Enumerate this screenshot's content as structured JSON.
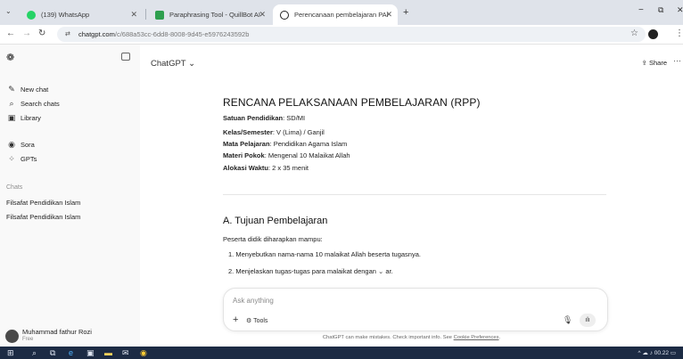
{
  "browser": {
    "tabs": [
      {
        "title": "(139) WhatsApp",
        "favicon": "whatsapp-icon",
        "color": "#25d366"
      },
      {
        "title": "Paraphrasing Tool - QuillBot AI",
        "favicon": "quillbot-icon",
        "color": "#2e9f4e"
      },
      {
        "title": "Perencanaan pembelajaran PAI",
        "favicon": "chatgpt-icon",
        "color": "#222222"
      }
    ],
    "new_tab": "+",
    "url_domain": "chatgpt.com",
    "url_path": "/c/688a53cc-6dd8-8008-9d45-e5976243592b",
    "window_controls": [
      "−",
      "⧉",
      "✕"
    ]
  },
  "sidebar": {
    "items": [
      {
        "label": "New chat",
        "icon": "new-chat-icon"
      },
      {
        "label": "Search chats",
        "icon": "search-icon"
      },
      {
        "label": "Library",
        "icon": "library-icon"
      },
      {
        "label": "Sora",
        "icon": "sora-icon"
      },
      {
        "label": "GPTs",
        "icon": "gpts-icon"
      }
    ],
    "section_label": "Chats",
    "history": [
      "Filsafat Pendidikan Islam",
      "Filsafat Pendidikan Islam"
    ],
    "user": {
      "name": "Muhammad fathur Rozi",
      "plan": "Free"
    }
  },
  "header": {
    "model": "ChatGPT ⌄",
    "share": "Share",
    "more": "···"
  },
  "document": {
    "title": "RENCANA PELAKSANAAN PEMBELAJARAN (RPP)",
    "meta": [
      {
        "label": "Satuan Pendidikan",
        "value": ": SD/MI"
      },
      {
        "label": "Kelas/Semester",
        "value": ": V (Lima) / Ganjil"
      },
      {
        "label": "Mata Pelajaran",
        "value": ": Pendidikan Agama Islam"
      },
      {
        "label": "Materi Pokok",
        "value": ": Mengenal 10 Malaikat Allah"
      },
      {
        "label": "Alokasi Waktu",
        "value": ": 2 x 35 menit"
      }
    ],
    "section_a": "A. Tujuan Pembelajaran",
    "intro": "Peserta didik diharapkan mampu:",
    "list": [
      "1.  Menyebutkan nama-nama 10 malaikat Allah beserta tugasnya.",
      "2.  Menjelaskan tugas-tugas para malaikat dengan",
      "ar."
    ]
  },
  "composer": {
    "placeholder": "Ask anything",
    "tools": "Tools",
    "disclaimer": "ChatGPT can make mistakes. Check important info. See",
    "disclaimer_link": "Cookie Preferences",
    "disclaimer_end": "."
  },
  "taskbar": {
    "time": "00.22"
  }
}
